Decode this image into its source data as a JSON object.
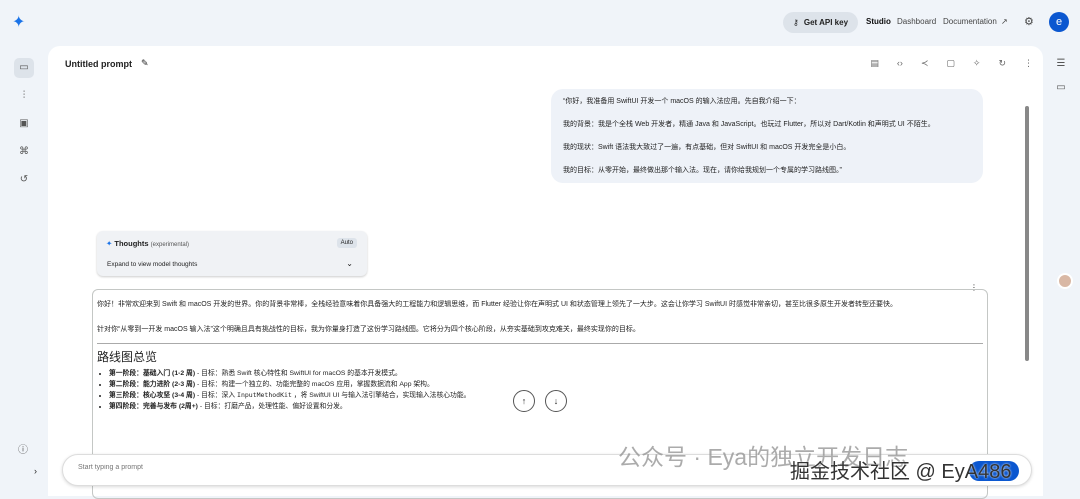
{
  "header": {
    "api_key": "Get API key",
    "nav": [
      "Studio",
      "Dashboard",
      "Documentation"
    ],
    "avatar": "e"
  },
  "prompt_title": "Untitled prompt",
  "user_message": [
    "“你好，我准备用 SwiftUI 开发一个 macOS 的输入法应用。先自我介绍一下：",
    "我的背景：我是个全栈 Web 开发者，精通 Java 和 JavaScript。也玩过 Flutter，所以对 Dart/Kotlin 和声明式 UI 不陌生。",
    "我的现状：Swift 语法我大致过了一遍，有点基础，但对 SwiftUI 和 macOS 开发完全是小白。",
    "我的目标：从零开始，最终做出那个输入法。现在，请你给我规划一个专属的学习路线图。”"
  ],
  "thoughts": {
    "title": "Thoughts",
    "tag": "(experimental)",
    "mode": "Auto",
    "expand": "Expand to view model thoughts"
  },
  "response": {
    "p1": "你好！非常欢迎来到 Swift 和 macOS 开发的世界。你的背景非常棒，全栈经验意味着你具备强大的工程能力和逻辑思维，而 Flutter 经验让你在声明式 UI 和状态管理上领先了一大步。这会让你学习 SwiftUI 时感觉非常亲切，甚至比很多原生开发者转型还要快。",
    "p2": "针对你“从零到一开发 macOS 输入法”这个明确且具有挑战性的目标，我为你量身打造了这份学习路线图。它将分为四个核心阶段，从夯实基础到攻克难关，最终实现你的目标。",
    "heading": "路线图总览",
    "items": [
      {
        "b": "第一阶段：基础入门 (1-2 周)",
        "t": " - 目标：熟悉 Swift 核心特性和 SwiftUI for macOS 的基本开发模式。"
      },
      {
        "b": "第二阶段：能力进阶 (2-3 周)",
        "t": " - 目标：构建一个独立的、功能完整的 macOS 应用，掌握数据流和 App 架构。"
      },
      {
        "b": "第三阶段：核心攻坚 (3-4 周)",
        "t": " - 目标：深入 ",
        "c": "InputMethodKit",
        "t2": " ，将 SwiftUI UI 与输入法引擎结合，实现输入法核心功能。"
      },
      {
        "b": "第四阶段：完善与发布 (2周+)",
        "t": " - 目标：打磨产品，处理性能、偏好设置和分发。"
      }
    ]
  },
  "prompt_placeholder": "Start typing a prompt",
  "watermarks": [
    "公众号 · Eya的独立开发日志",
    "掘金技术社区 @ EyA486"
  ]
}
